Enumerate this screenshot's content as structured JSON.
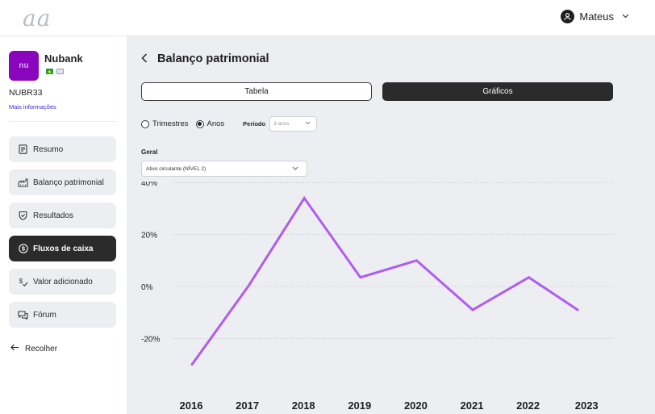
{
  "header": {
    "logo": "aa",
    "user_name": "Mateus"
  },
  "company": {
    "logo_text": "nu",
    "name": "Nubank",
    "ticker": "NUBR33",
    "more_info": "Mais informações"
  },
  "nav": [
    {
      "label": "Resumo",
      "icon": "document-icon",
      "active": false
    },
    {
      "label": "Balanço patrimonial",
      "icon": "factory-icon",
      "active": false
    },
    {
      "label": "Resultados",
      "icon": "shield-check-icon",
      "active": false
    },
    {
      "label": "Fluxos de caixa",
      "icon": "dollar-circle-icon",
      "active": true
    },
    {
      "label": "Valor adicionado",
      "icon": "dollar-arrow-icon",
      "active": false
    },
    {
      "label": "Fórum",
      "icon": "chat-icon",
      "active": false
    }
  ],
  "collapse_label": "Recolher",
  "page": {
    "title": "Balanço patrimonial",
    "toggle_table": "Tabela",
    "toggle_charts": "Gráficos",
    "radio_quarters": "Trimestres",
    "radio_years": "Anos",
    "period_label": "Período",
    "period_value": "3 anos",
    "group_label": "Geral",
    "metric_value": "Ativo circulante (NÍVEL 2)"
  },
  "colors": {
    "line": "#b15cf0",
    "accent": "#8a05be",
    "active_nav": "#2b2b2b"
  },
  "chart_data": {
    "type": "line",
    "x": [
      "2016",
      "2017",
      "2018",
      "2019",
      "2020",
      "2021",
      "2022",
      "2023"
    ],
    "series": [
      {
        "values": [
          -30,
          0,
          34,
          3.5,
          10,
          -9,
          3.5,
          -9
        ]
      }
    ],
    "y_ticks": [
      "40%",
      "20%",
      "0%",
      "-20%"
    ],
    "ylim": [
      -30,
      40
    ],
    "grid": true
  }
}
